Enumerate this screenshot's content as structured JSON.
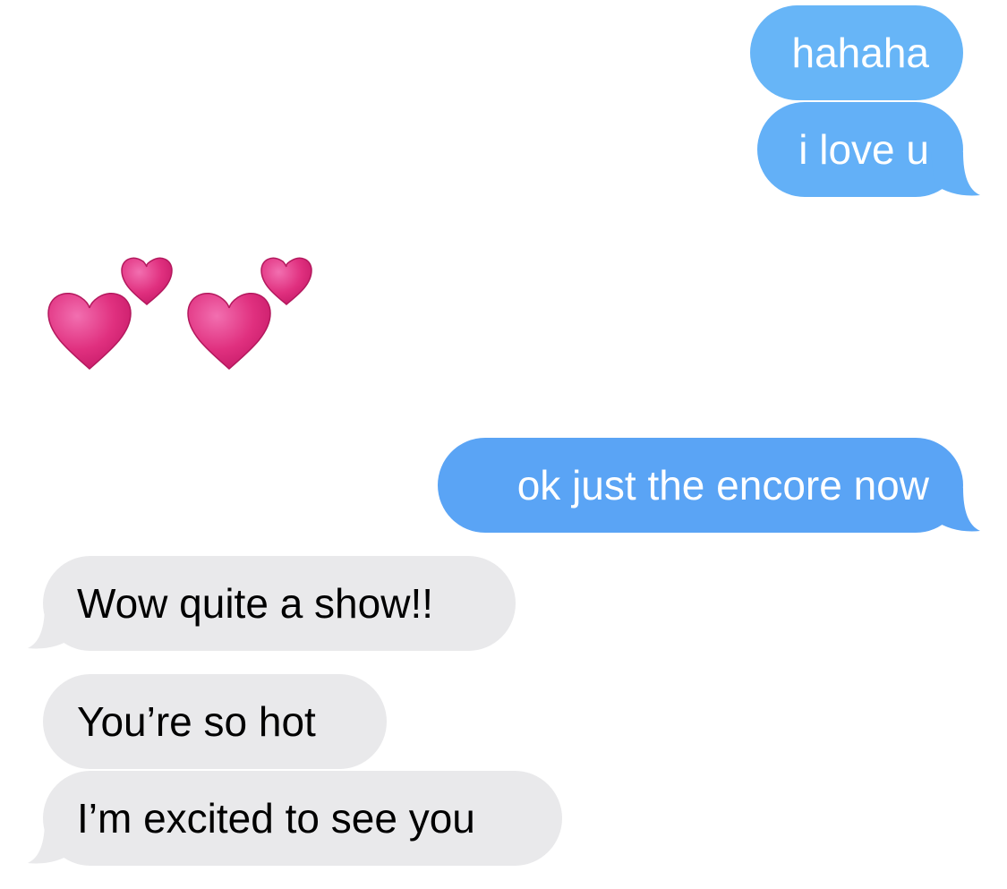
{
  "conversation": {
    "sent_color": "#5fa9f6",
    "received_color": "#e9e9eb",
    "messages": [
      {
        "from": "me",
        "text": "hahaha"
      },
      {
        "from": "me",
        "text": "i love u"
      },
      {
        "from": "them",
        "emoji": "two-hearts",
        "count": 2
      },
      {
        "from": "me",
        "text": "ok just the encore now"
      },
      {
        "from": "them",
        "text": "Wow quite a show!!"
      },
      {
        "from": "them",
        "text": "You’re so hot"
      },
      {
        "from": "them",
        "text": "I’m excited to see you"
      }
    ]
  },
  "icons": {
    "two_hearts": "two-hearts-icon",
    "heart_color": "#e0307f"
  }
}
